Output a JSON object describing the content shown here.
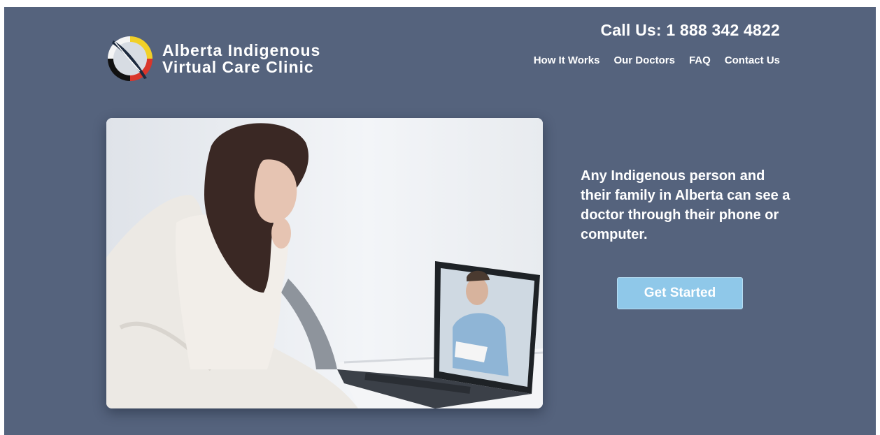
{
  "brand": {
    "line1": "Alberta Indigenous",
    "line2": "Virtual Care Clinic"
  },
  "header": {
    "phone": "Call Us: 1 888 342 4822",
    "nav": [
      {
        "label": "How It Works"
      },
      {
        "label": "Our Doctors"
      },
      {
        "label": "FAQ"
      },
      {
        "label": "Contact Us"
      }
    ]
  },
  "hero": {
    "tagline": "Any Indigenous person and their family in Alberta can see a doctor through their phone or computer.",
    "cta_label": "Get Started"
  },
  "colors": {
    "background": "#55637d",
    "cta": "#8fc8e9",
    "text": "#ffffff"
  },
  "icons": {
    "logo": "medicine-wheel-feather-logo"
  }
}
